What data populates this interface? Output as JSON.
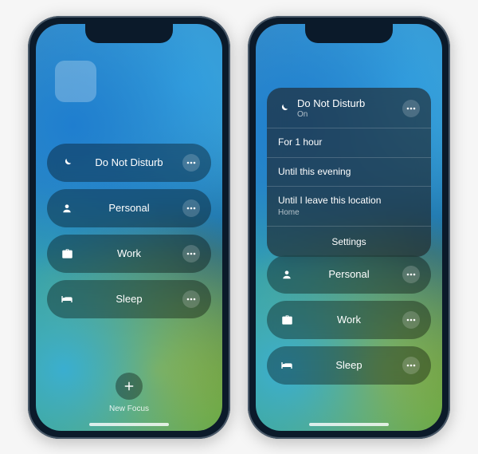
{
  "focus_items": [
    {
      "icon": "moon",
      "label": "Do Not Disturb"
    },
    {
      "icon": "person",
      "label": "Personal"
    },
    {
      "icon": "bag",
      "label": "Work"
    },
    {
      "icon": "bed",
      "label": "Sleep"
    }
  ],
  "new_focus_label": "New Focus",
  "expanded": {
    "icon": "moon",
    "title": "Do Not Disturb",
    "status": "On",
    "options": [
      {
        "label": "For 1 hour"
      },
      {
        "label": "Until this evening"
      },
      {
        "label": "Until I leave this location",
        "sub": "Home"
      }
    ],
    "settings_label": "Settings"
  }
}
